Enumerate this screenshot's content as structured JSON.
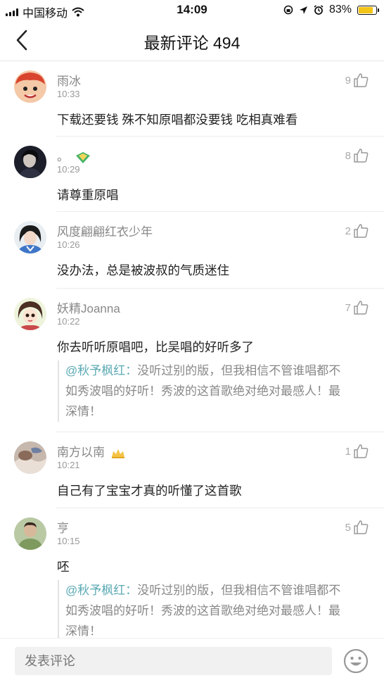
{
  "status_bar": {
    "carrier": "中国移动",
    "time": "14:09",
    "battery": "83%",
    "battery_level": 0.83
  },
  "nav": {
    "title": "最新评论 494"
  },
  "comments": [
    {
      "user": "雨冰",
      "time": "10:33",
      "likes": "9",
      "text": "下载还要钱 殊不知原唱都没要钱 吃相真难看"
    },
    {
      "user": "。",
      "time": "10:29",
      "likes": "8",
      "text": "请尊重原唱"
    },
    {
      "user": "风度翩翩红衣少年",
      "time": "10:26",
      "likes": "2",
      "text": "没办法，总是被波叔的气质迷住"
    },
    {
      "user": "妖精Joanna",
      "time": "10:22",
      "likes": "7",
      "text": "你去听听原唱吧，比吴唱的好听多了",
      "reply": {
        "at": "@秋予枫红：",
        "lines": [
          "没听过别的版，但我相信不管谁唱都不",
          "如秀波唱的好听！秀波的这首歌绝对绝对最感人！最",
          "深情！"
        ]
      }
    },
    {
      "user": "南方以南",
      "time": "10:21",
      "likes": "1",
      "text": "自己有了宝宝才真的听懂了这首歌"
    },
    {
      "user": "亨",
      "time": "10:15",
      "likes": "5",
      "text": "呸",
      "reply": {
        "at": "@秋予枫红：",
        "lines": [
          "没听过别的版，但我相信不管谁唱都不",
          "如秀波唱的好听！秀波的这首歌绝对绝对最感人！最",
          "深情！"
        ]
      }
    }
  ],
  "bottom_bar": {
    "placeholder": "发表评论"
  }
}
